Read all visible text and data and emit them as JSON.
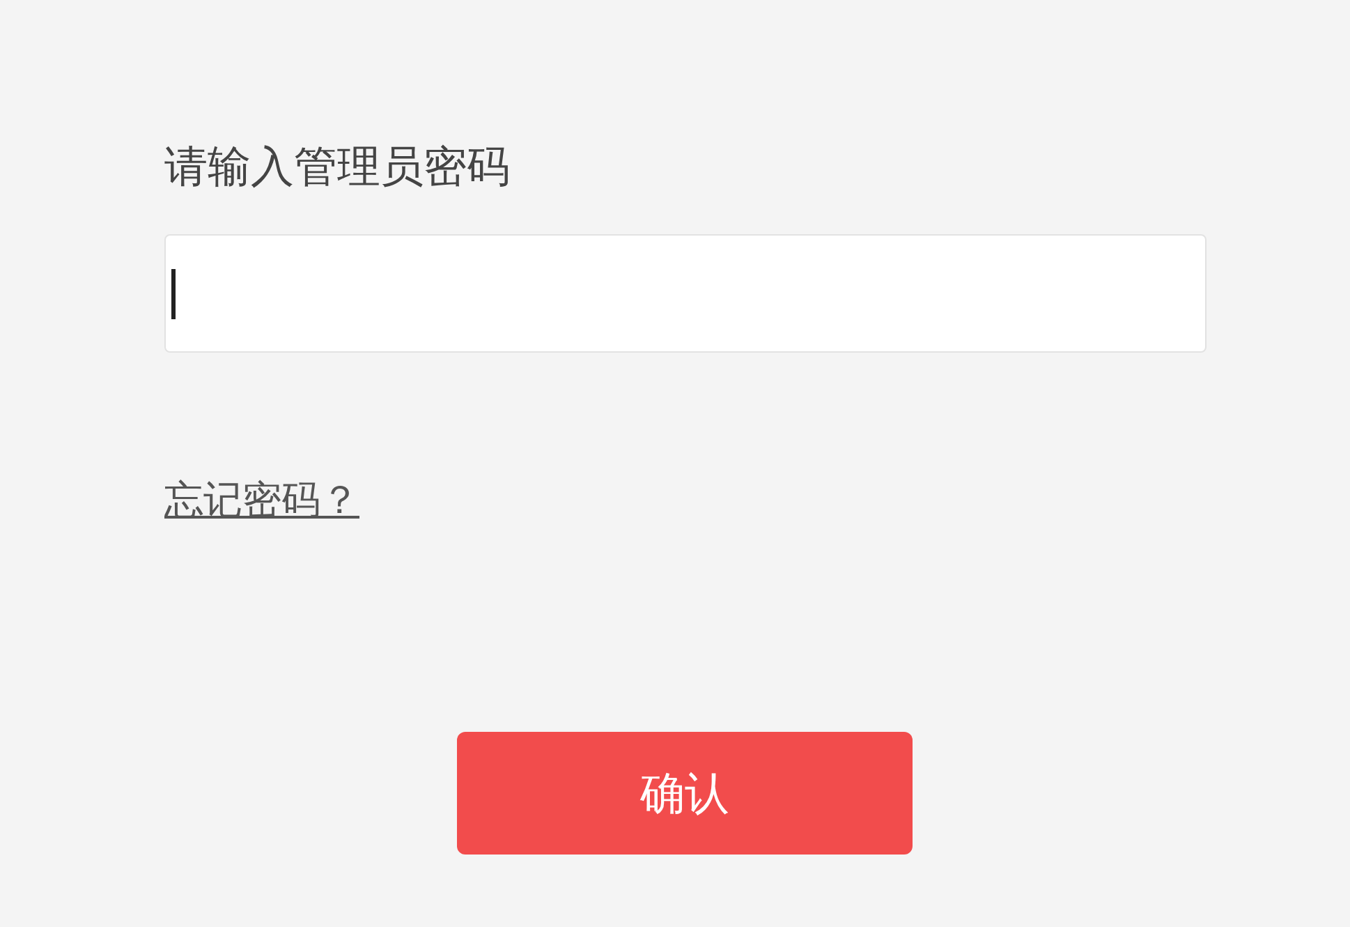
{
  "prompt": "请输入管理员密码",
  "password_field": {
    "focused": true
  },
  "forgot_link": "忘记密码？",
  "confirm_button": "确认"
}
